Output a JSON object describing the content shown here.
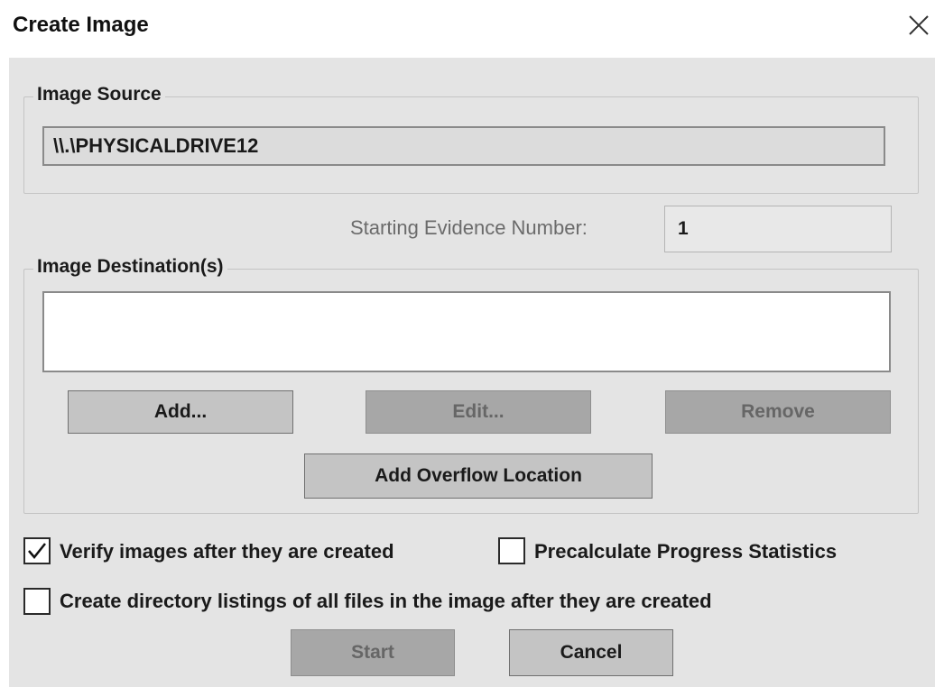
{
  "window": {
    "title": "Create Image",
    "close_icon": "close-icon"
  },
  "image_source": {
    "label": "Image Source",
    "value": "\\\\.\\PHYSICALDRIVE12"
  },
  "evidence": {
    "label": "Starting Evidence Number:",
    "value": "1"
  },
  "image_destinations": {
    "label": "Image Destination(s)",
    "items": [],
    "buttons": {
      "add": "Add...",
      "edit": "Edit...",
      "remove": "Remove",
      "add_overflow": "Add Overflow Location"
    },
    "buttons_enabled": {
      "add": true,
      "edit": false,
      "remove": false,
      "add_overflow": true
    }
  },
  "options": {
    "verify": {
      "label": "Verify images after they are created",
      "checked": true
    },
    "precalculate": {
      "label": "Precalculate Progress Statistics",
      "checked": false
    },
    "directory_listing": {
      "label": "Create directory listings of all files in the image after they are created",
      "checked": false
    }
  },
  "footer": {
    "start": "Start",
    "cancel": "Cancel",
    "start_enabled": false
  },
  "colors": {
    "client_bg": "#e4e4e4",
    "button_enabled": "#c4c4c4",
    "button_disabled": "#a7a7a7"
  }
}
